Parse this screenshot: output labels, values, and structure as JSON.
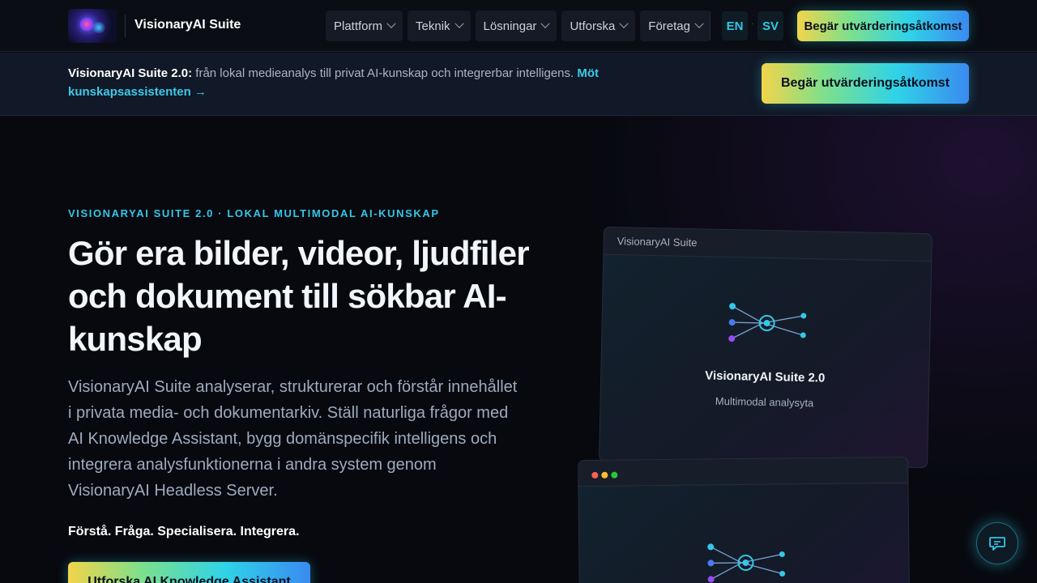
{
  "nav": {
    "logo_alt": "VisionaryAI logo",
    "brand": "VisionaryAI Suite",
    "items": [
      {
        "label": "Plattform"
      },
      {
        "label": "Teknik"
      },
      {
        "label": "Lösningar"
      },
      {
        "label": "Utforska"
      },
      {
        "label": "Företag"
      }
    ],
    "lang_en": "EN",
    "lang_dot": "·",
    "lang_sv": "SV",
    "cta": "Begär utvärderingsåtkomst"
  },
  "banner": {
    "title": "VisionaryAI Suite 2.0:",
    "text": " från lokal medieanalys till privat AI-kunskap och integrerbar intelligens. ",
    "link": "Möt kunskapsassistenten →",
    "cta": "Begär utvärderingsåtkomst"
  },
  "hero": {
    "eyebrow": "VISIONARYAI SUITE 2.0 · LOKAL MULTIMODAL AI-KUNSKAP",
    "headline": "Gör era bilder, videor, ljudfiler och dokument till sökbar AI-kunskap",
    "lead": "VisionaryAI Suite analyserar, strukturerar och förstår innehållet i privata media- och dokumentarkiv. Ställ naturliga frågor med AI Knowledge Assistant, bygg domänspecifik intelligens och integrera analysfunktionerna i andra system genom VisionaryAI Headless Server.",
    "tagline": "Förstå. Fråga. Specialisera. Integrera.",
    "cta": "Utforska AI Knowledge Assistant"
  },
  "mockup1": {
    "window_title": "VisionaryAI Suite",
    "title": "VisionaryAI Suite 2.0",
    "subtitle": "Multimodal analysyta"
  },
  "colors": {
    "accent": "#33c7e8",
    "background": "#07090f",
    "gradient": [
      "#f3d44a",
      "#2fd3e8",
      "#3a8af0"
    ]
  },
  "icons": {
    "chat": "chat-icon",
    "chevron": "chevron-down-icon",
    "network": "network-graph-icon"
  }
}
